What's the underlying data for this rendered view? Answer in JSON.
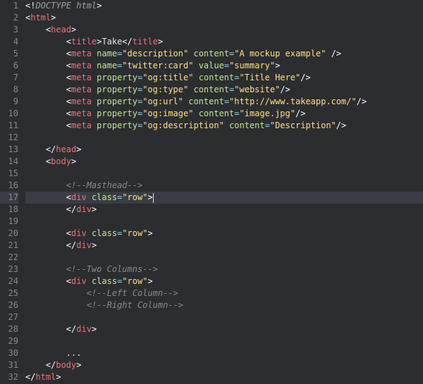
{
  "lines": [
    {
      "n": "1",
      "indent": 0,
      "tokens": [
        [
          "bracket",
          "<!"
        ],
        [
          "doctype",
          "DOCTYPE html"
        ],
        [
          "bracket",
          ">"
        ]
      ]
    },
    {
      "n": "2",
      "indent": 0,
      "tokens": [
        [
          "bracket",
          "<"
        ],
        [
          "tag",
          "html"
        ],
        [
          "bracket",
          ">"
        ]
      ]
    },
    {
      "n": "3",
      "indent": 1,
      "tokens": [
        [
          "bracket",
          "<"
        ],
        [
          "tag",
          "head"
        ],
        [
          "bracket",
          ">"
        ]
      ]
    },
    {
      "n": "4",
      "indent": 2,
      "tokens": [
        [
          "bracket",
          "<"
        ],
        [
          "tag",
          "title"
        ],
        [
          "bracket",
          ">"
        ],
        [
          "text",
          "Take"
        ],
        [
          "bracket",
          "</"
        ],
        [
          "tag",
          "title"
        ],
        [
          "bracket",
          ">"
        ]
      ]
    },
    {
      "n": "5",
      "indent": 2,
      "tokens": [
        [
          "bracket",
          "<"
        ],
        [
          "tag",
          "meta"
        ],
        [
          "text",
          " "
        ],
        [
          "attr",
          "name"
        ],
        [
          "eq",
          "="
        ],
        [
          "string",
          "\"description\""
        ],
        [
          "text",
          " "
        ],
        [
          "attr",
          "content"
        ],
        [
          "eq",
          "="
        ],
        [
          "string",
          "\"A mockup example\""
        ],
        [
          "text",
          " "
        ],
        [
          "bracket",
          "/>"
        ]
      ]
    },
    {
      "n": "6",
      "indent": 2,
      "tokens": [
        [
          "bracket",
          "<"
        ],
        [
          "tag",
          "meta"
        ],
        [
          "text",
          " "
        ],
        [
          "attr",
          "name"
        ],
        [
          "eq",
          "="
        ],
        [
          "string",
          "\"twitter:card\""
        ],
        [
          "text",
          " "
        ],
        [
          "attr",
          "value"
        ],
        [
          "eq",
          "="
        ],
        [
          "string",
          "\"summary\""
        ],
        [
          "bracket",
          ">"
        ]
      ]
    },
    {
      "n": "7",
      "indent": 2,
      "tokens": [
        [
          "bracket",
          "<"
        ],
        [
          "tag",
          "meta"
        ],
        [
          "text",
          " "
        ],
        [
          "attr",
          "property"
        ],
        [
          "eq",
          "="
        ],
        [
          "string",
          "\"og:title\""
        ],
        [
          "text",
          " "
        ],
        [
          "attr",
          "content"
        ],
        [
          "eq",
          "="
        ],
        [
          "string",
          "\"Title Here\""
        ],
        [
          "bracket",
          "/>"
        ]
      ]
    },
    {
      "n": "8",
      "indent": 2,
      "tokens": [
        [
          "bracket",
          "<"
        ],
        [
          "tag",
          "meta"
        ],
        [
          "text",
          " "
        ],
        [
          "attr",
          "property"
        ],
        [
          "eq",
          "="
        ],
        [
          "string",
          "\"og:type\""
        ],
        [
          "text",
          " "
        ],
        [
          "attr",
          "content"
        ],
        [
          "eq",
          "="
        ],
        [
          "string",
          "\"website\""
        ],
        [
          "bracket",
          "/>"
        ]
      ]
    },
    {
      "n": "9",
      "indent": 2,
      "tokens": [
        [
          "bracket",
          "<"
        ],
        [
          "tag",
          "meta"
        ],
        [
          "text",
          " "
        ],
        [
          "attr",
          "property"
        ],
        [
          "eq",
          "="
        ],
        [
          "string",
          "\"og:url\""
        ],
        [
          "text",
          " "
        ],
        [
          "attr",
          "content"
        ],
        [
          "eq",
          "="
        ],
        [
          "string",
          "\"http://www.takeapp.com/\""
        ],
        [
          "bracket",
          "/>"
        ]
      ]
    },
    {
      "n": "10",
      "indent": 2,
      "tokens": [
        [
          "bracket",
          "<"
        ],
        [
          "tag",
          "meta"
        ],
        [
          "text",
          " "
        ],
        [
          "attr",
          "property"
        ],
        [
          "eq",
          "="
        ],
        [
          "string",
          "\"og:image\""
        ],
        [
          "text",
          " "
        ],
        [
          "attr",
          "content"
        ],
        [
          "eq",
          "="
        ],
        [
          "string",
          "\"image.jpg\""
        ],
        [
          "bracket",
          "/>"
        ]
      ]
    },
    {
      "n": "11",
      "indent": 2,
      "tokens": [
        [
          "bracket",
          "<"
        ],
        [
          "tag",
          "meta"
        ],
        [
          "text",
          " "
        ],
        [
          "attr",
          "property"
        ],
        [
          "eq",
          "="
        ],
        [
          "string",
          "\"og:description\""
        ],
        [
          "text",
          " "
        ],
        [
          "attr",
          "content"
        ],
        [
          "eq",
          "="
        ],
        [
          "string",
          "\"Description\""
        ],
        [
          "bracket",
          "/>"
        ]
      ]
    },
    {
      "n": "12",
      "indent": 0,
      "tokens": []
    },
    {
      "n": "13",
      "indent": 1,
      "tokens": [
        [
          "bracket",
          "</"
        ],
        [
          "tag",
          "head"
        ],
        [
          "bracket",
          ">"
        ]
      ]
    },
    {
      "n": "14",
      "indent": 1,
      "tokens": [
        [
          "bracket",
          "<"
        ],
        [
          "tag",
          "body"
        ],
        [
          "bracket",
          ">"
        ]
      ]
    },
    {
      "n": "15",
      "indent": 0,
      "tokens": []
    },
    {
      "n": "16",
      "indent": 2,
      "tokens": [
        [
          "comment",
          "<!--Masthead-->"
        ]
      ]
    },
    {
      "n": "17",
      "indent": 2,
      "tokens": [
        [
          "bracket",
          "<"
        ],
        [
          "tag",
          "div"
        ],
        [
          "text",
          " "
        ],
        [
          "attr",
          "class"
        ],
        [
          "eq",
          "="
        ],
        [
          "string",
          "\"row\""
        ],
        [
          "bracket",
          ">"
        ]
      ],
      "active": true,
      "cursor": true
    },
    {
      "n": "18",
      "indent": 2,
      "tokens": [
        [
          "bracket",
          "</"
        ],
        [
          "tag",
          "div"
        ],
        [
          "bracket",
          ">"
        ]
      ]
    },
    {
      "n": "19",
      "indent": 0,
      "tokens": []
    },
    {
      "n": "20",
      "indent": 2,
      "tokens": [
        [
          "bracket",
          "<"
        ],
        [
          "tag",
          "div"
        ],
        [
          "text",
          " "
        ],
        [
          "attr",
          "class"
        ],
        [
          "eq",
          "="
        ],
        [
          "string",
          "\"row\""
        ],
        [
          "bracket",
          ">"
        ]
      ]
    },
    {
      "n": "21",
      "indent": 2,
      "tokens": [
        [
          "bracket",
          "</"
        ],
        [
          "tag",
          "div"
        ],
        [
          "bracket",
          ">"
        ]
      ]
    },
    {
      "n": "22",
      "indent": 0,
      "tokens": []
    },
    {
      "n": "23",
      "indent": 2,
      "tokens": [
        [
          "comment",
          "<!--Two Columns-->"
        ]
      ]
    },
    {
      "n": "24",
      "indent": 2,
      "tokens": [
        [
          "bracket",
          "<"
        ],
        [
          "tag",
          "div"
        ],
        [
          "text",
          " "
        ],
        [
          "attr",
          "class"
        ],
        [
          "eq",
          "="
        ],
        [
          "string",
          "\"row\""
        ],
        [
          "bracket",
          ">"
        ]
      ]
    },
    {
      "n": "25",
      "indent": 3,
      "tokens": [
        [
          "comment",
          "<!--Left Column-->"
        ]
      ]
    },
    {
      "n": "26",
      "indent": 3,
      "tokens": [
        [
          "comment",
          "<!--Right Column-->"
        ]
      ]
    },
    {
      "n": "27",
      "indent": 0,
      "tokens": []
    },
    {
      "n": "28",
      "indent": 2,
      "tokens": [
        [
          "bracket",
          "</"
        ],
        [
          "tag",
          "div"
        ],
        [
          "bracket",
          ">"
        ]
      ]
    },
    {
      "n": "29",
      "indent": 0,
      "tokens": []
    },
    {
      "n": "30",
      "indent": 2,
      "tokens": [
        [
          "text",
          "..."
        ]
      ]
    },
    {
      "n": "31",
      "indent": 1,
      "tokens": [
        [
          "bracket",
          "</"
        ],
        [
          "tag",
          "body"
        ],
        [
          "bracket",
          ">"
        ]
      ]
    },
    {
      "n": "32",
      "indent": 0,
      "tokens": [
        [
          "bracket",
          "</"
        ],
        [
          "tag",
          "html"
        ],
        [
          "bracket",
          ">"
        ]
      ]
    }
  ]
}
